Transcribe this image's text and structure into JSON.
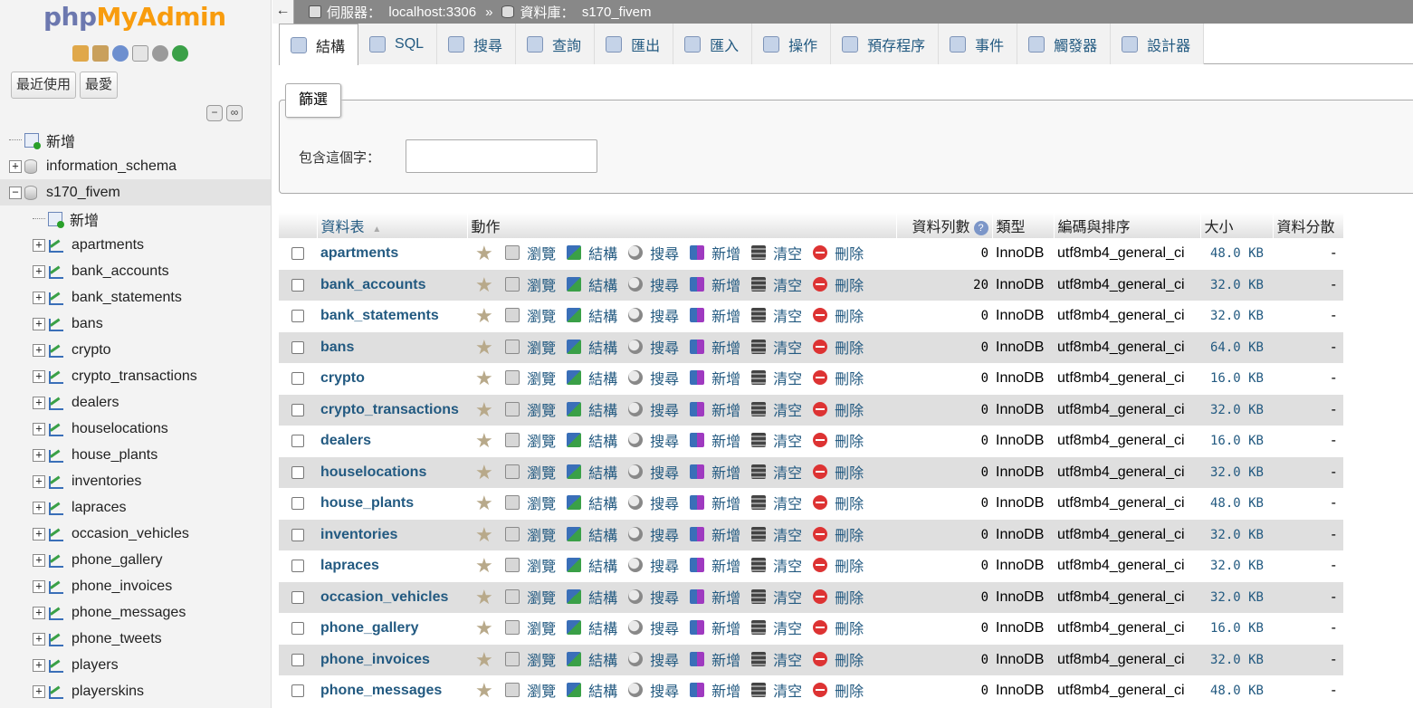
{
  "nav": {
    "logo_php": "php",
    "logo_myadmin": "MyAdmin",
    "recent_label": "最近使用",
    "favorites_label": "最愛",
    "tree": {
      "new_label": "新增",
      "databases": [
        {
          "name": "information_schema",
          "expanded": false
        },
        {
          "name": "s170_fivem",
          "expanded": true
        }
      ],
      "db_new_label": "新增",
      "tables": [
        "apartments",
        "bank_accounts",
        "bank_statements",
        "bans",
        "crypto",
        "crypto_transactions",
        "dealers",
        "houselocations",
        "house_plants",
        "inventories",
        "lapraces",
        "occasion_vehicles",
        "phone_gallery",
        "phone_invoices",
        "phone_messages",
        "phone_tweets",
        "players",
        "playerskins"
      ]
    }
  },
  "breadcrumb": {
    "server_label": "伺服器：",
    "server_value": "localhost:3306",
    "separator": "»",
    "db_label": "資料庫：",
    "db_value": "s170_fivem"
  },
  "tabs": [
    {
      "label": "結構",
      "active": true
    },
    {
      "label": "SQL"
    },
    {
      "label": "搜尋"
    },
    {
      "label": "查詢"
    },
    {
      "label": "匯出"
    },
    {
      "label": "匯入"
    },
    {
      "label": "操作"
    },
    {
      "label": "預存程序"
    },
    {
      "label": "事件"
    },
    {
      "label": "觸發器"
    },
    {
      "label": "設計器"
    }
  ],
  "filter": {
    "legend": "篩選",
    "label": "包含這個字：",
    "value": ""
  },
  "table": {
    "headers": {
      "name": "資料表",
      "sort_indicator": "▲",
      "action": "動作",
      "rows": "資料列數",
      "type": "類型",
      "collation": "編碼與排序",
      "size": "大小",
      "overhead": "資料分散"
    },
    "actions": {
      "browse": "瀏覽",
      "structure": "結構",
      "search": "搜尋",
      "insert": "新增",
      "empty": "清空",
      "drop": "刪除"
    },
    "rows": [
      {
        "name": "apartments",
        "rows": "0",
        "type": "InnoDB",
        "collation": "utf8mb4_general_ci",
        "size": "48.0 KB",
        "overhead": "-"
      },
      {
        "name": "bank_accounts",
        "rows": "20",
        "type": "InnoDB",
        "collation": "utf8mb4_general_ci",
        "size": "32.0 KB",
        "overhead": "-"
      },
      {
        "name": "bank_statements",
        "rows": "0",
        "type": "InnoDB",
        "collation": "utf8mb4_general_ci",
        "size": "32.0 KB",
        "overhead": "-"
      },
      {
        "name": "bans",
        "rows": "0",
        "type": "InnoDB",
        "collation": "utf8mb4_general_ci",
        "size": "64.0 KB",
        "overhead": "-"
      },
      {
        "name": "crypto",
        "rows": "0",
        "type": "InnoDB",
        "collation": "utf8mb4_general_ci",
        "size": "16.0 KB",
        "overhead": "-"
      },
      {
        "name": "crypto_transactions",
        "rows": "0",
        "type": "InnoDB",
        "collation": "utf8mb4_general_ci",
        "size": "32.0 KB",
        "overhead": "-"
      },
      {
        "name": "dealers",
        "rows": "0",
        "type": "InnoDB",
        "collation": "utf8mb4_general_ci",
        "size": "16.0 KB",
        "overhead": "-"
      },
      {
        "name": "houselocations",
        "rows": "0",
        "type": "InnoDB",
        "collation": "utf8mb4_general_ci",
        "size": "32.0 KB",
        "overhead": "-"
      },
      {
        "name": "house_plants",
        "rows": "0",
        "type": "InnoDB",
        "collation": "utf8mb4_general_ci",
        "size": "48.0 KB",
        "overhead": "-"
      },
      {
        "name": "inventories",
        "rows": "0",
        "type": "InnoDB",
        "collation": "utf8mb4_general_ci",
        "size": "32.0 KB",
        "overhead": "-"
      },
      {
        "name": "lapraces",
        "rows": "0",
        "type": "InnoDB",
        "collation": "utf8mb4_general_ci",
        "size": "32.0 KB",
        "overhead": "-"
      },
      {
        "name": "occasion_vehicles",
        "rows": "0",
        "type": "InnoDB",
        "collation": "utf8mb4_general_ci",
        "size": "32.0 KB",
        "overhead": "-"
      },
      {
        "name": "phone_gallery",
        "rows": "0",
        "type": "InnoDB",
        "collation": "utf8mb4_general_ci",
        "size": "16.0 KB",
        "overhead": "-"
      },
      {
        "name": "phone_invoices",
        "rows": "0",
        "type": "InnoDB",
        "collation": "utf8mb4_general_ci",
        "size": "32.0 KB",
        "overhead": "-"
      },
      {
        "name": "phone_messages",
        "rows": "0",
        "type": "InnoDB",
        "collation": "utf8mb4_general_ci",
        "size": "48.0 KB",
        "overhead": "-"
      }
    ]
  },
  "icons": {
    "back": "back-arrow-icon",
    "server": "server-icon",
    "database": "database-icon"
  },
  "colors": {
    "link": "#235a81",
    "logo_php": "#6c78af",
    "logo_myadmin": "#f89c0e"
  }
}
